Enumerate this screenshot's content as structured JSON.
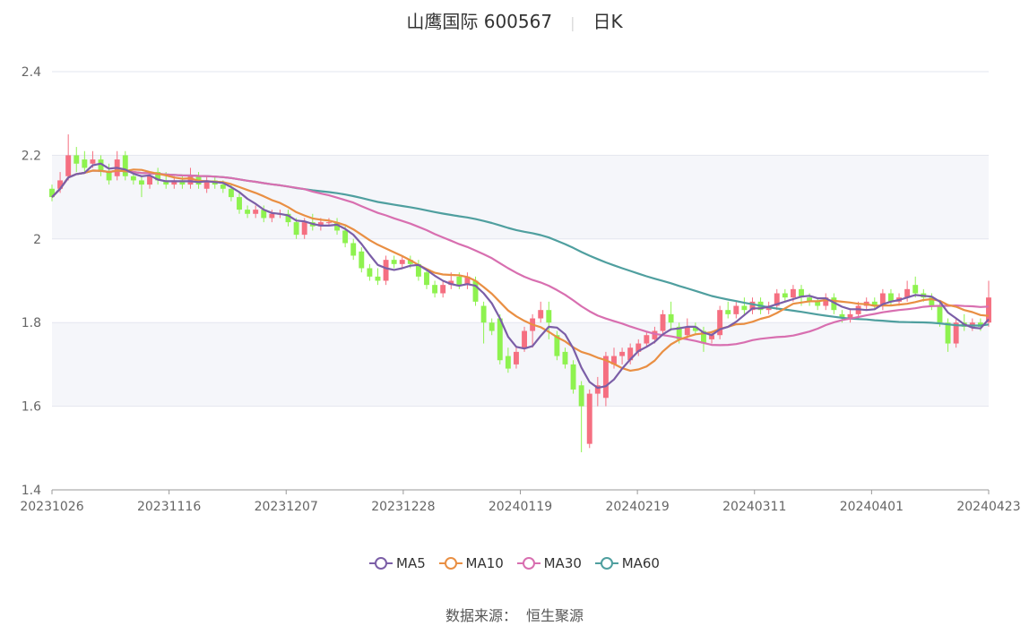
{
  "header": {
    "name": "山鹰国际 600567",
    "period": "日K"
  },
  "source": {
    "label": "数据来源：",
    "value": "恒生聚源"
  },
  "colors": {
    "up": "#f56f81",
    "down": "#8ef24f",
    "MA5": "#7b5ea7",
    "MA10": "#e98f43",
    "MA30": "#d86fb0",
    "MA60": "#4f9f9f",
    "grid": "#e3e6ef",
    "band": "#f5f6fa"
  },
  "chart_data": {
    "type": "candlestick",
    "title": "山鹰国际 600567 日K",
    "ylim": [
      1.4,
      2.4
    ],
    "yticks": [
      "2.4",
      "2.2",
      "2",
      "1.8",
      "1.6",
      "1.4"
    ],
    "xticks": [
      "20231026",
      "20231116",
      "20231207",
      "20231228",
      "20240119",
      "20240219",
      "20240311",
      "20240401",
      "20240423"
    ],
    "legend": [
      "MA5",
      "MA10",
      "MA30",
      "MA60"
    ],
    "candles": [
      {
        "o": 2.12,
        "c": 2.1,
        "h": 2.13,
        "l": 2.09
      },
      {
        "o": 2.12,
        "c": 2.14,
        "h": 2.16,
        "l": 2.11
      },
      {
        "o": 2.15,
        "c": 2.2,
        "h": 2.25,
        "l": 2.14
      },
      {
        "o": 2.2,
        "c": 2.18,
        "h": 2.22,
        "l": 2.16
      },
      {
        "o": 2.19,
        "c": 2.17,
        "h": 2.21,
        "l": 2.16
      },
      {
        "o": 2.18,
        "c": 2.19,
        "h": 2.21,
        "l": 2.17
      },
      {
        "o": 2.19,
        "c": 2.16,
        "h": 2.2,
        "l": 2.15
      },
      {
        "o": 2.16,
        "c": 2.14,
        "h": 2.18,
        "l": 2.13
      },
      {
        "o": 2.15,
        "c": 2.19,
        "h": 2.21,
        "l": 2.14
      },
      {
        "o": 2.2,
        "c": 2.15,
        "h": 2.21,
        "l": 2.14
      },
      {
        "o": 2.15,
        "c": 2.14,
        "h": 2.16,
        "l": 2.13
      },
      {
        "o": 2.14,
        "c": 2.13,
        "h": 2.15,
        "l": 2.1
      },
      {
        "o": 2.13,
        "c": 2.15,
        "h": 2.16,
        "l": 2.12
      },
      {
        "o": 2.16,
        "c": 2.14,
        "h": 2.17,
        "l": 2.13
      },
      {
        "o": 2.14,
        "c": 2.13,
        "h": 2.16,
        "l": 2.12
      },
      {
        "o": 2.13,
        "c": 2.14,
        "h": 2.15,
        "l": 2.12
      },
      {
        "o": 2.14,
        "c": 2.13,
        "h": 2.15,
        "l": 2.12
      },
      {
        "o": 2.13,
        "c": 2.15,
        "h": 2.17,
        "l": 2.12
      },
      {
        "o": 2.15,
        "c": 2.13,
        "h": 2.16,
        "l": 2.12
      },
      {
        "o": 2.12,
        "c": 2.14,
        "h": 2.15,
        "l": 2.11
      },
      {
        "o": 2.14,
        "c": 2.13,
        "h": 2.15,
        "l": 2.12
      },
      {
        "o": 2.13,
        "c": 2.12,
        "h": 2.14,
        "l": 2.11
      },
      {
        "o": 2.12,
        "c": 2.1,
        "h": 2.13,
        "l": 2.09
      },
      {
        "o": 2.1,
        "c": 2.07,
        "h": 2.11,
        "l": 2.06
      },
      {
        "o": 2.07,
        "c": 2.06,
        "h": 2.08,
        "l": 2.05
      },
      {
        "o": 2.06,
        "c": 2.07,
        "h": 2.08,
        "l": 2.05
      },
      {
        "o": 2.07,
        "c": 2.05,
        "h": 2.08,
        "l": 2.04
      },
      {
        "o": 2.05,
        "c": 2.06,
        "h": 2.07,
        "l": 2.04
      },
      {
        "o": 2.06,
        "c": 2.06,
        "h": 2.07,
        "l": 2.05
      },
      {
        "o": 2.06,
        "c": 2.04,
        "h": 2.07,
        "l": 2.03
      },
      {
        "o": 2.04,
        "c": 2.01,
        "h": 2.05,
        "l": 2.0
      },
      {
        "o": 2.01,
        "c": 2.04,
        "h": 2.05,
        "l": 2.0
      },
      {
        "o": 2.04,
        "c": 2.03,
        "h": 2.06,
        "l": 2.02
      },
      {
        "o": 2.03,
        "c": 2.04,
        "h": 2.05,
        "l": 2.02
      },
      {
        "o": 2.04,
        "c": 2.04,
        "h": 2.05,
        "l": 2.03
      },
      {
        "o": 2.04,
        "c": 2.02,
        "h": 2.05,
        "l": 2.01
      },
      {
        "o": 2.02,
        "c": 1.99,
        "h": 2.03,
        "l": 1.98
      },
      {
        "o": 1.99,
        "c": 1.96,
        "h": 2.0,
        "l": 1.95
      },
      {
        "o": 1.97,
        "c": 1.93,
        "h": 1.98,
        "l": 1.92
      },
      {
        "o": 1.93,
        "c": 1.91,
        "h": 1.94,
        "l": 1.9
      },
      {
        "o": 1.91,
        "c": 1.9,
        "h": 1.93,
        "l": 1.89
      },
      {
        "o": 1.9,
        "c": 1.95,
        "h": 1.96,
        "l": 1.89
      },
      {
        "o": 1.95,
        "c": 1.94,
        "h": 1.96,
        "l": 1.93
      },
      {
        "o": 1.94,
        "c": 1.95,
        "h": 1.96,
        "l": 1.93
      },
      {
        "o": 1.95,
        "c": 1.94,
        "h": 1.96,
        "l": 1.93
      },
      {
        "o": 1.94,
        "c": 1.91,
        "h": 1.95,
        "l": 1.9
      },
      {
        "o": 1.92,
        "c": 1.89,
        "h": 1.93,
        "l": 1.88
      },
      {
        "o": 1.89,
        "c": 1.87,
        "h": 1.9,
        "l": 1.86
      },
      {
        "o": 1.87,
        "c": 1.89,
        "h": 1.9,
        "l": 1.86
      },
      {
        "o": 1.89,
        "c": 1.9,
        "h": 1.92,
        "l": 1.88
      },
      {
        "o": 1.91,
        "c": 1.89,
        "h": 1.92,
        "l": 1.88
      },
      {
        "o": 1.89,
        "c": 1.91,
        "h": 1.92,
        "l": 1.88
      },
      {
        "o": 1.9,
        "c": 1.85,
        "h": 1.91,
        "l": 1.84
      },
      {
        "o": 1.84,
        "c": 1.8,
        "h": 1.85,
        "l": 1.75
      },
      {
        "o": 1.8,
        "c": 1.78,
        "h": 1.81,
        "l": 1.77
      },
      {
        "o": 1.81,
        "c": 1.71,
        "h": 1.82,
        "l": 1.7
      },
      {
        "o": 1.72,
        "c": 1.69,
        "h": 1.74,
        "l": 1.68
      },
      {
        "o": 1.7,
        "c": 1.73,
        "h": 1.74,
        "l": 1.69
      },
      {
        "o": 1.74,
        "c": 1.78,
        "h": 1.79,
        "l": 1.73
      },
      {
        "o": 1.78,
        "c": 1.81,
        "h": 1.82,
        "l": 1.74
      },
      {
        "o": 1.81,
        "c": 1.83,
        "h": 1.85,
        "l": 1.8
      },
      {
        "o": 1.83,
        "c": 1.8,
        "h": 1.85,
        "l": 1.76
      },
      {
        "o": 1.77,
        "c": 1.72,
        "h": 1.78,
        "l": 1.71
      },
      {
        "o": 1.73,
        "c": 1.7,
        "h": 1.74,
        "l": 1.69
      },
      {
        "o": 1.7,
        "c": 1.64,
        "h": 1.71,
        "l": 1.63
      },
      {
        "o": 1.65,
        "c": 1.6,
        "h": 1.66,
        "l": 1.49
      },
      {
        "o": 1.51,
        "c": 1.63,
        "h": 1.64,
        "l": 1.5
      },
      {
        "o": 1.63,
        "c": 1.65,
        "h": 1.67,
        "l": 1.6
      },
      {
        "o": 1.62,
        "c": 1.72,
        "h": 1.73,
        "l": 1.6
      },
      {
        "o": 1.7,
        "c": 1.72,
        "h": 1.74,
        "l": 1.69
      },
      {
        "o": 1.72,
        "c": 1.73,
        "h": 1.74,
        "l": 1.7
      },
      {
        "o": 1.71,
        "c": 1.74,
        "h": 1.75,
        "l": 1.7
      },
      {
        "o": 1.73,
        "c": 1.75,
        "h": 1.76,
        "l": 1.72
      },
      {
        "o": 1.75,
        "c": 1.77,
        "h": 1.78,
        "l": 1.74
      },
      {
        "o": 1.76,
        "c": 1.78,
        "h": 1.79,
        "l": 1.75
      },
      {
        "o": 1.78,
        "c": 1.82,
        "h": 1.83,
        "l": 1.77
      },
      {
        "o": 1.82,
        "c": 1.8,
        "h": 1.85,
        "l": 1.78
      },
      {
        "o": 1.79,
        "c": 1.76,
        "h": 1.8,
        "l": 1.75
      },
      {
        "o": 1.77,
        "c": 1.79,
        "h": 1.81,
        "l": 1.76
      },
      {
        "o": 1.79,
        "c": 1.78,
        "h": 1.8,
        "l": 1.77
      },
      {
        "o": 1.78,
        "c": 1.75,
        "h": 1.79,
        "l": 1.73
      },
      {
        "o": 1.76,
        "c": 1.77,
        "h": 1.78,
        "l": 1.75
      },
      {
        "o": 1.77,
        "c": 1.83,
        "h": 1.84,
        "l": 1.76
      },
      {
        "o": 1.83,
        "c": 1.82,
        "h": 1.85,
        "l": 1.81
      },
      {
        "o": 1.82,
        "c": 1.84,
        "h": 1.85,
        "l": 1.81
      },
      {
        "o": 1.84,
        "c": 1.83,
        "h": 1.86,
        "l": 1.82
      },
      {
        "o": 1.83,
        "c": 1.85,
        "h": 1.86,
        "l": 1.82
      },
      {
        "o": 1.85,
        "c": 1.83,
        "h": 1.86,
        "l": 1.82
      },
      {
        "o": 1.83,
        "c": 1.84,
        "h": 1.85,
        "l": 1.82
      },
      {
        "o": 1.84,
        "c": 1.87,
        "h": 1.88,
        "l": 1.83
      },
      {
        "o": 1.87,
        "c": 1.86,
        "h": 1.88,
        "l": 1.85
      },
      {
        "o": 1.86,
        "c": 1.88,
        "h": 1.89,
        "l": 1.85
      },
      {
        "o": 1.88,
        "c": 1.86,
        "h": 1.89,
        "l": 1.84
      },
      {
        "o": 1.86,
        "c": 1.85,
        "h": 1.87,
        "l": 1.84
      },
      {
        "o": 1.85,
        "c": 1.84,
        "h": 1.86,
        "l": 1.83
      },
      {
        "o": 1.84,
        "c": 1.86,
        "h": 1.87,
        "l": 1.83
      },
      {
        "o": 1.86,
        "c": 1.83,
        "h": 1.87,
        "l": 1.82
      },
      {
        "o": 1.82,
        "c": 1.81,
        "h": 1.83,
        "l": 1.8
      },
      {
        "o": 1.81,
        "c": 1.82,
        "h": 1.83,
        "l": 1.8
      },
      {
        "o": 1.82,
        "c": 1.84,
        "h": 1.85,
        "l": 1.81
      },
      {
        "o": 1.84,
        "c": 1.85,
        "h": 1.86,
        "l": 1.83
      },
      {
        "o": 1.85,
        "c": 1.84,
        "h": 1.86,
        "l": 1.83
      },
      {
        "o": 1.84,
        "c": 1.87,
        "h": 1.88,
        "l": 1.83
      },
      {
        "o": 1.87,
        "c": 1.85,
        "h": 1.88,
        "l": 1.84
      },
      {
        "o": 1.85,
        "c": 1.86,
        "h": 1.87,
        "l": 1.84
      },
      {
        "o": 1.86,
        "c": 1.88,
        "h": 1.9,
        "l": 1.85
      },
      {
        "o": 1.89,
        "c": 1.87,
        "h": 1.91,
        "l": 1.86
      },
      {
        "o": 1.87,
        "c": 1.86,
        "h": 1.88,
        "l": 1.85
      },
      {
        "o": 1.86,
        "c": 1.84,
        "h": 1.87,
        "l": 1.83
      },
      {
        "o": 1.84,
        "c": 1.8,
        "h": 1.85,
        "l": 1.79
      },
      {
        "o": 1.8,
        "c": 1.75,
        "h": 1.81,
        "l": 1.73
      },
      {
        "o": 1.75,
        "c": 1.8,
        "h": 1.81,
        "l": 1.74
      },
      {
        "o": 1.8,
        "c": 1.79,
        "h": 1.82,
        "l": 1.78
      },
      {
        "o": 1.79,
        "c": 1.8,
        "h": 1.81,
        "l": 1.78
      },
      {
        "o": 1.8,
        "c": 1.79,
        "h": 1.81,
        "l": 1.78
      },
      {
        "o": 1.8,
        "c": 1.86,
        "h": 1.9,
        "l": 1.79
      }
    ]
  }
}
